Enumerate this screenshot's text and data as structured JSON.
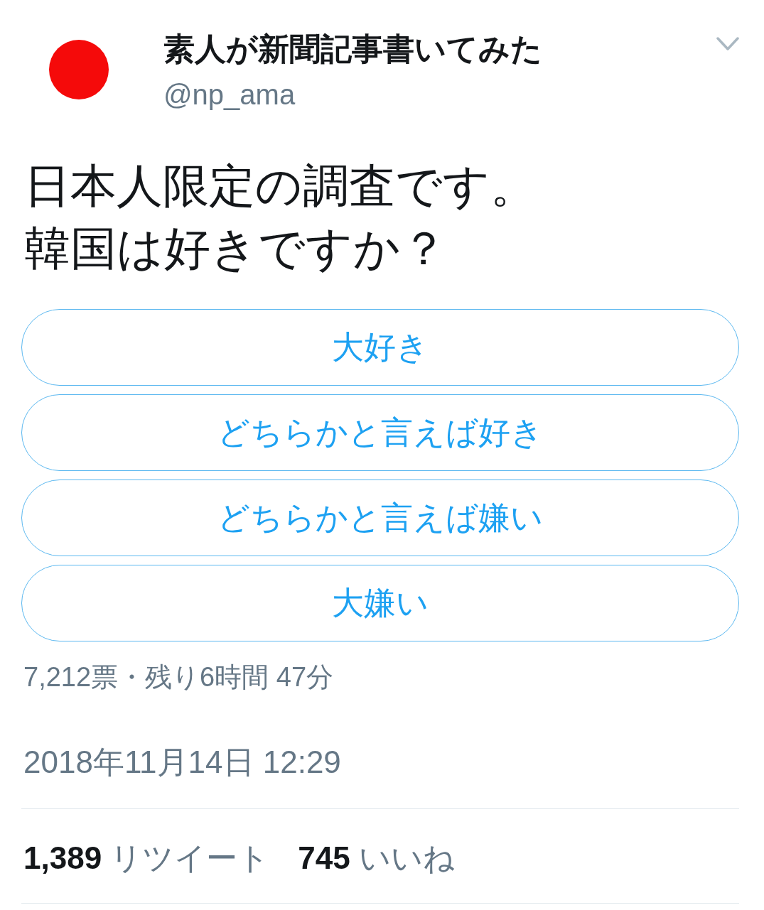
{
  "account": {
    "name": "素人が新聞記事書いてみた",
    "handle": "@np_ama"
  },
  "tweet": {
    "lines": [
      "日本人限定の調査です。",
      "韓国は好きですか？"
    ]
  },
  "poll": {
    "options": [
      {
        "label": "大好き"
      },
      {
        "label": "どちらかと言えば好き"
      },
      {
        "label": "どちらかと言えば嫌い"
      },
      {
        "label": "大嫌い"
      }
    ],
    "summary": "7,212票・残り6時間 47分"
  },
  "timestamp": "2018年11月14日 12:29",
  "stats": [
    {
      "text": "**1,389** リツイート"
    },
    {
      "text": "**745** いいね"
    }
  ]
}
